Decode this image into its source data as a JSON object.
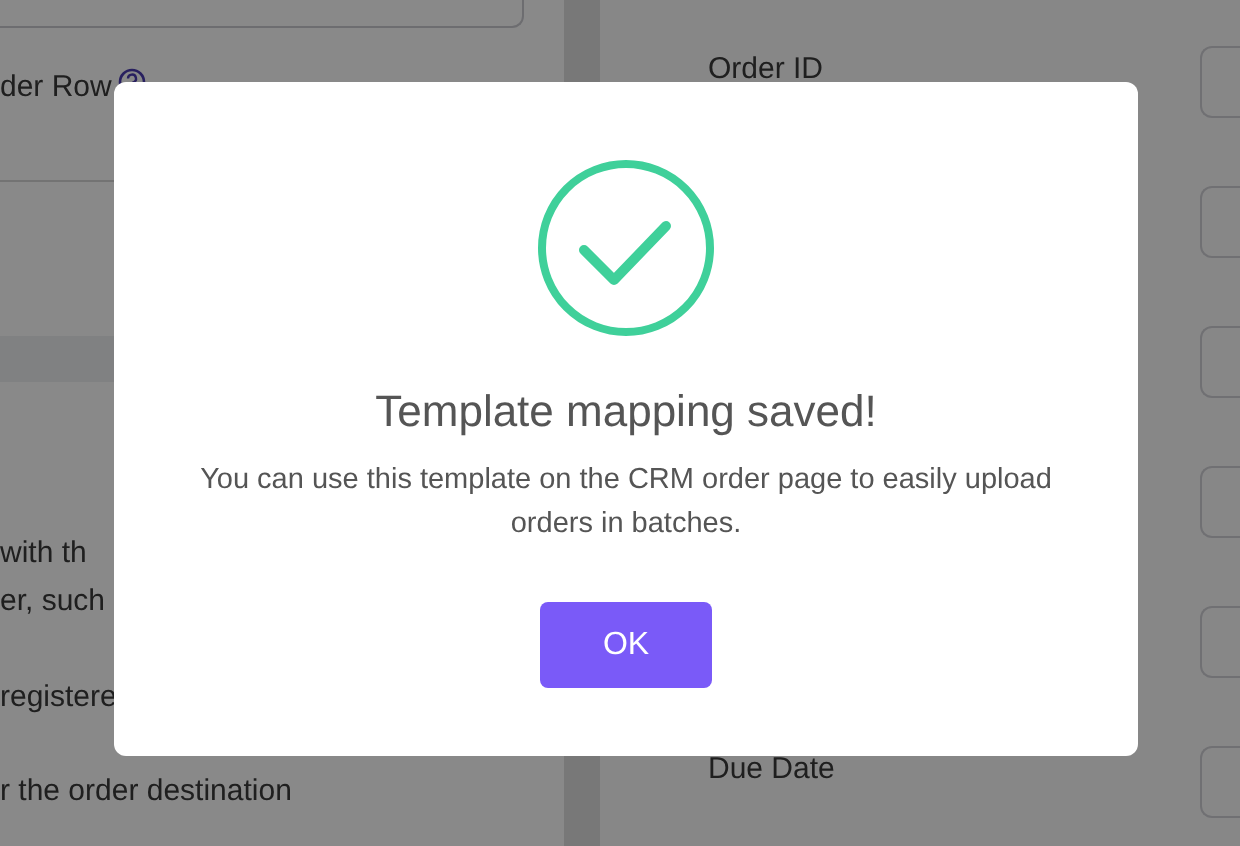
{
  "background": {
    "left_panel": {
      "row_label": "der Row",
      "notes": [
        "with th",
        "er, such",
        "registere",
        "r the order destination"
      ]
    },
    "right_panel": {
      "first_label": "Order ID",
      "last_label": "Due Date"
    }
  },
  "dialog": {
    "kind": "success",
    "title": "Template mapping saved!",
    "message": "You can use this template on the CRM order page to easily upload orders in batches.",
    "button": "OK"
  }
}
